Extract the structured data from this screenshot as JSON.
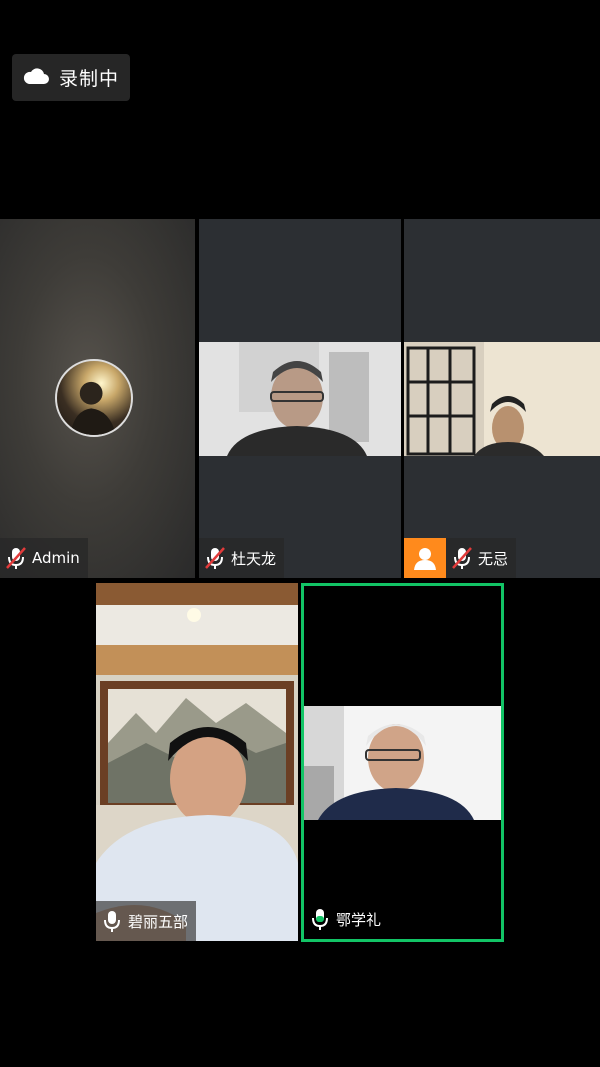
{
  "recording": {
    "label": "录制中",
    "icon": "cloud-icon"
  },
  "participants": [
    {
      "name": "Admin",
      "mic": "muted"
    },
    {
      "name": "杜天龙",
      "mic": "muted"
    },
    {
      "name": "无忌",
      "mic": "muted",
      "avatar_icon": "person-icon",
      "avatar_color": "#ff8a1c"
    },
    {
      "name": "碧丽五部",
      "mic": "on"
    },
    {
      "name": "鄂学礼",
      "mic": "on",
      "active_speaker": true,
      "highlight_color": "#12c466"
    }
  ]
}
